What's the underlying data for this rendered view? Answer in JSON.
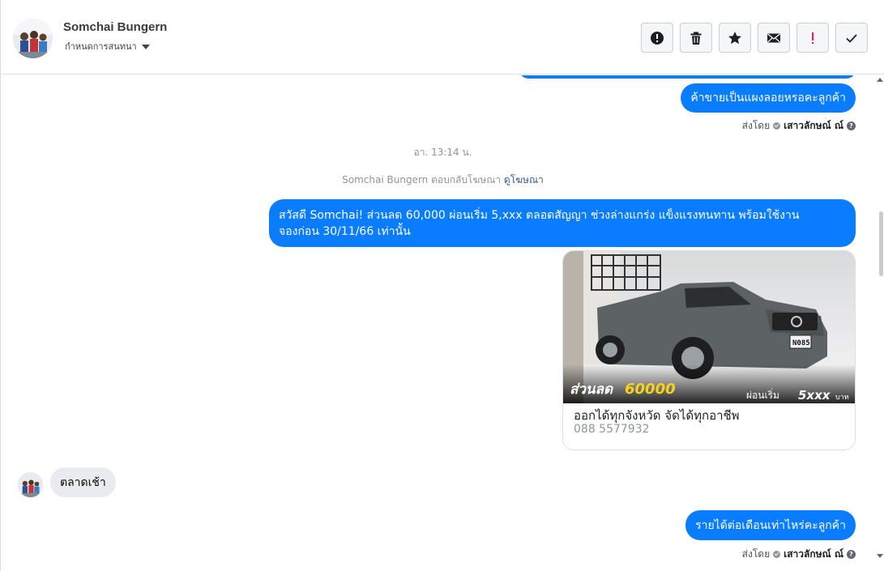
{
  "header": {
    "contact_name": "Somchai Bungern",
    "assign_label": "กำหนดการสนทนา",
    "toolbar": [
      {
        "name": "spam-button",
        "icon": "alert-circle-icon"
      },
      {
        "name": "delete-button",
        "icon": "trash-icon"
      },
      {
        "name": "star-button",
        "icon": "star-icon"
      },
      {
        "name": "mark-unread-button",
        "icon": "envelope-icon"
      },
      {
        "name": "mark-important-button",
        "icon": "exclamation-icon"
      },
      {
        "name": "mark-done-button",
        "icon": "check-icon"
      }
    ]
  },
  "messages": {
    "out_1": "ค้าขายเป็นแผงลอยหรอคะลูกค้า",
    "sent_by_label": "ส่งโดย",
    "sender_name": "เสาวลักษณ์ ณ์",
    "timestamp": "อา. 13:14 น.",
    "ad_reply_text": "Somchai Bungern ตอบกลับโฆษณา",
    "ad_reply_link": "ดูโฆษณา",
    "out_2_line1": "สวัสดี Somchai! ส่วนลด 60,000 ผ่อนเริ่ม 5,xxx ตลอดสัญญา ช่วงล่างแกร่ง แข็งแรงทนทาน พร้อมใช้งาน",
    "out_2_line2": "จองก่อน 30/11/66 เท่านั้น",
    "card": {
      "image_banner_left": "ส่วนลด",
      "image_banner_amount": "60000",
      "image_banner_right": "ผ่อนเริ่ม",
      "image_banner_price": "5xxx",
      "image_banner_unit": "บาท",
      "plate": "N085",
      "title": "ออกได้ทุกจังหวัด จัดได้ทุกอาชีพ",
      "phone": "088 5577932"
    },
    "in_1": "ตลาดเช้า",
    "out_3": "รายได้ต่อเดือนเท่าไหร่คะลูกค้า"
  },
  "colors": {
    "brand_blue": "#0a7cff",
    "incoming_gray": "#e9ebee"
  }
}
